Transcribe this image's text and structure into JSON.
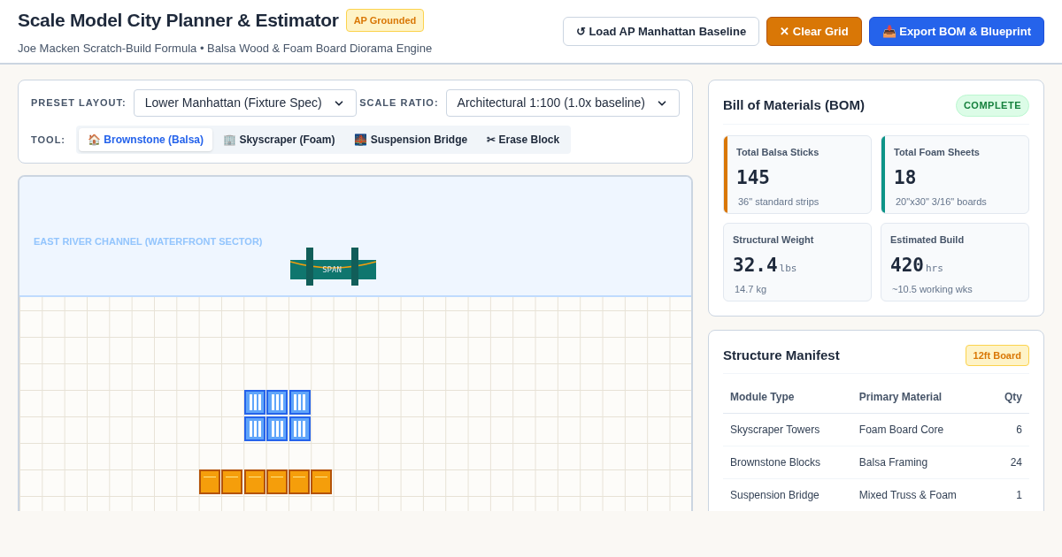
{
  "header": {
    "title": "Scale Model City Planner & Estimator",
    "badge": "AP Grounded",
    "subtitle": "Joe Macken Scratch-Build Formula • Balsa Wood & Foam Board Diorama Engine",
    "buttons": [
      {
        "kind": "outline",
        "label": "↺ Load AP Manhattan Baseline"
      },
      {
        "kind": "warning",
        "label": "✕ Clear Grid"
      },
      {
        "kind": "primary",
        "label": "📥 Export BOM & Blueprint"
      }
    ]
  },
  "controls": {
    "preset": {
      "label": "PRESET LAYOUT:",
      "value": "Lower Manhattan (Fixture Spec)"
    },
    "scale": {
      "label": "SCALE RATIO:",
      "value": "Architectural 1:100 (1.0x baseline)"
    },
    "tool_label": "TOOL:",
    "tools": [
      {
        "icon": "🏠",
        "label": "Brownstone (Balsa)",
        "selected": true
      },
      {
        "icon": "🏢",
        "label": "Skyscraper (Foam)",
        "selected": false
      },
      {
        "icon": "🌉",
        "label": "Suspension Bridge",
        "selected": false
      },
      {
        "icon": "✂",
        "label": "Erase Block",
        "selected": false
      }
    ]
  },
  "canvas": {
    "water_label": "EAST RIVER CHANNEL (WATERFRONT SECTOR)",
    "bridge": {
      "label": "SPAN"
    },
    "clusters": [
      {
        "kind": "skyscraper",
        "blocks": [
          {
            "kind": "skyscraper"
          },
          {
            "kind": "skyscraper"
          },
          {
            "kind": "skyscraper"
          },
          {
            "kind": "skyscraper"
          },
          {
            "kind": "skyscraper"
          },
          {
            "kind": "skyscraper"
          }
        ]
      },
      {
        "kind": "brownstone",
        "blocks": [
          {
            "kind": "brownstone"
          },
          {
            "kind": "brownstone"
          },
          {
            "kind": "brownstone"
          },
          {
            "kind": "brownstone"
          },
          {
            "kind": "brownstone"
          },
          {
            "kind": "brownstone"
          }
        ]
      }
    ]
  },
  "bom": {
    "title": "Bill of Materials (BOM)",
    "status": "COMPLETE",
    "stats": [
      {
        "label": "Total Balsa Sticks",
        "value": "145",
        "note": "36\" standard strips",
        "color": "#d97706"
      },
      {
        "label": "Total Foam Sheets",
        "value": "18",
        "note": "20\"x30\" 3/16\" boards",
        "color": "#0d9488"
      },
      {
        "label": "Structural Weight",
        "value": "32.4",
        "unit": "lbs",
        "note": "14.7 kg"
      },
      {
        "label": "Estimated Build",
        "value": "420",
        "unit": "hrs",
        "note": "~10.5 working wks"
      }
    ]
  },
  "manifest": {
    "title": "Structure Manifest",
    "badge": "12ft Board",
    "columns": [
      "Module Type",
      "Primary Material",
      "Qty"
    ],
    "rows": [
      [
        "Skyscraper Towers",
        "Foam Board Core",
        "6"
      ],
      [
        "Brownstone Blocks",
        "Balsa Framing",
        "24"
      ],
      [
        "Suspension Bridge",
        "Mixed Truss & Foam",
        "1"
      ]
    ]
  }
}
